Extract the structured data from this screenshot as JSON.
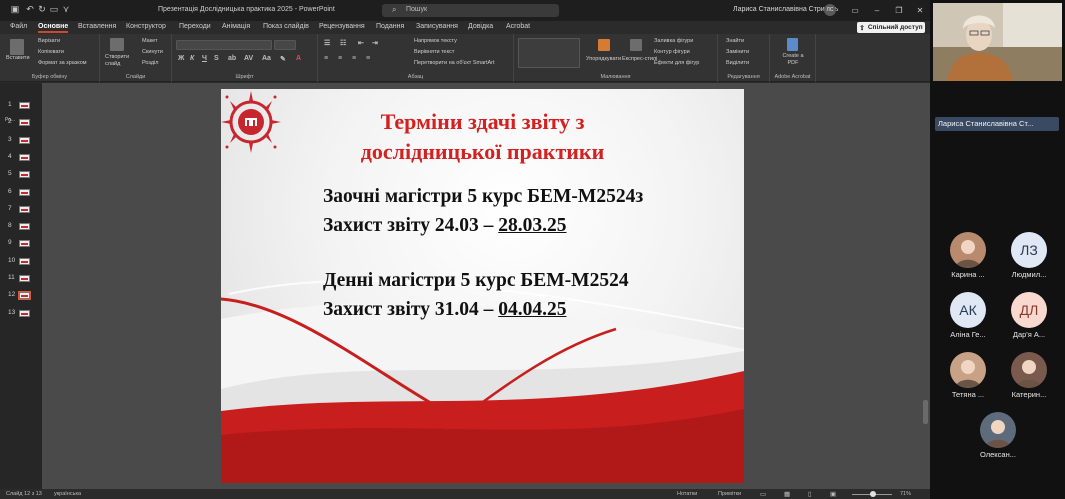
{
  "titlebar": {
    "doc_title": "Презентація Дослідницька практика 2025  -  PowerPoint",
    "search_placeholder": "Пошук",
    "user_name": "Лариса Станиславівна Стригуль",
    "user_initials": "ЛС"
  },
  "tabs": [
    "Файл",
    "Основне",
    "Вставлення",
    "Конструктор",
    "Переходи",
    "Анімація",
    "Показ слайдів",
    "Рецензування",
    "Подання",
    "Записування",
    "Довідка",
    "Acrobat"
  ],
  "active_tab": "Основне",
  "share_button": "Спільний доступ",
  "ribbon": {
    "clipboard": {
      "paste": "Вставити",
      "cut": "Вирізати",
      "copy": "Копіювати",
      "format_painter": "Формат за зразком",
      "label": "Буфер обміну"
    },
    "slides": {
      "new_slide": "Створити слайд",
      "layout": "Макет",
      "reset": "Скинути",
      "section": "Розділ",
      "label": "Слайди"
    },
    "font": {
      "label": "Шрифт"
    },
    "paragraph": {
      "text_direction": "Напрямок тексту",
      "align_text": "Вирівняти текст",
      "convert_smartart": "Перетворити на об'єкт SmartArt",
      "label": "Абзац"
    },
    "drawing": {
      "arrange": "Упорядкувати",
      "quick_styles": "Експрес-стилі",
      "shape_fill": "Заливка фігури",
      "shape_outline": "Контур фігури",
      "shape_effects": "Ефекти для фігур",
      "label": "Малювання"
    },
    "editing": {
      "find": "Знайти",
      "replace": "Замінити",
      "select": "Виділити",
      "label": "Редагування"
    },
    "adobe": {
      "create_pdf": "Create a PDF",
      "label": "Adobe Acrobat"
    }
  },
  "thumbnails": {
    "header": "Ро...",
    "numbers": [
      "1",
      "2",
      "3",
      "4",
      "5",
      "6",
      "7",
      "8",
      "9",
      "10",
      "11",
      "12",
      "13"
    ],
    "active": "12"
  },
  "slide": {
    "title_line1": "Терміни здачі звіту з",
    "title_line2": "дослідницької практики",
    "group1_line1": "Заочні магістри 5 курс БЕМ-М2524з",
    "group1_defense_prefix": "Захист звіту 24.03 – ",
    "group1_defense_end": "28.03.25",
    "group2_line1": "Денні магістри 5 курс БЕМ-М2524",
    "group2_defense_prefix": "Захист звіту 31.04 – ",
    "group2_defense_end": "04.04.25"
  },
  "status": {
    "slide_info": "Слайд 12 з 13",
    "language": "українська",
    "notes": "Нотатки",
    "comments": "Примітки",
    "zoom": "71%"
  },
  "call": {
    "host_name": "Лариса Станиславівна Ст...",
    "participants": [
      {
        "name": "Карина ...",
        "initials": "",
        "kind": "photo"
      },
      {
        "name": "Людмил...",
        "initials": "ЛЗ",
        "kind": "initials"
      },
      {
        "name": "Аліна Ге...",
        "initials": "АК",
        "kind": "initials"
      },
      {
        "name": "Дар'я А...",
        "initials": "ДЛ",
        "kind": "initials"
      },
      {
        "name": "Тетяна ...",
        "initials": "",
        "kind": "photo"
      },
      {
        "name": "Катерин...",
        "initials": "",
        "kind": "photo"
      },
      {
        "name": "Олексан...",
        "initials": "",
        "kind": "photo"
      }
    ]
  },
  "colors": {
    "slide_title": "#d42020",
    "wave_red": "#c81e1e",
    "accent_tab": "#c74b2f",
    "host_label_bg": "#3b4a63"
  }
}
